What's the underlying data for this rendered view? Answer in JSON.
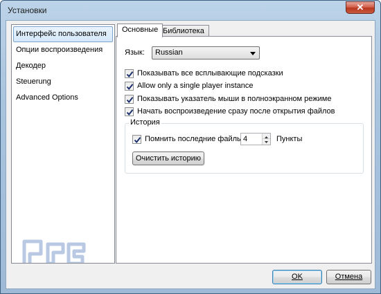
{
  "window": {
    "title": "Установки",
    "close_glyph": "✕"
  },
  "sidebar": {
    "items": [
      {
        "label": "Интерфейс пользователя",
        "selected": true
      },
      {
        "label": "Опции воспроизведения",
        "selected": false
      },
      {
        "label": "Декодер",
        "selected": false
      },
      {
        "label": "Steuerung",
        "selected": false
      },
      {
        "label": "Advanced Options",
        "selected": false
      }
    ],
    "watermark": "FERRA.RU"
  },
  "tabs": [
    {
      "label": "Основные",
      "active": true
    },
    {
      "label": "Библиотека",
      "active": false
    }
  ],
  "general": {
    "language_label": "Язык:",
    "language_value": "Russian",
    "checkboxes": [
      {
        "label": "Показывать все всплывающие подсказки",
        "checked": true
      },
      {
        "label": "Allow only a single player instance",
        "checked": true
      },
      {
        "label": "Показывать указатель мыши в полноэкранном режиме",
        "checked": true
      },
      {
        "label": "Начать воспроизведение сразу после открытия файлов",
        "checked": true
      }
    ],
    "history": {
      "title": "История",
      "remember_label": "Помнить последние файлы:",
      "remember_checked": true,
      "count": "4",
      "unit": "Пункты",
      "clear_button": "Очистить историю"
    }
  },
  "footer": {
    "ok_label": "OK",
    "cancel_label": "Отмена"
  },
  "colors": {
    "title_bar": "#a9c4df",
    "close_button": "#c85a3f",
    "selection": "#d4e8fb",
    "watermark": "#b9c9e3"
  }
}
